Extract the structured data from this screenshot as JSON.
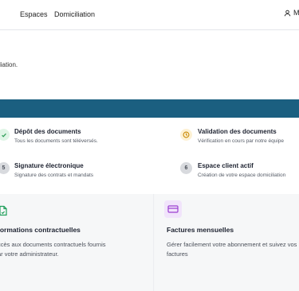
{
  "header": {
    "nav": [
      {
        "label": "Espaces"
      },
      {
        "label": "Domiciliation"
      }
    ],
    "account": {
      "label": "M",
      "icon": "user-icon"
    }
  },
  "intro": {
    "text": "liation."
  },
  "steps": [
    {
      "number": "",
      "status": "done",
      "title": "Dépôt des documents",
      "description": "Tous les documents sont téléversés.",
      "icon": "check-icon"
    },
    {
      "number": "",
      "status": "in-progress",
      "title": "Validation des documents",
      "description": "Vérification en cours par notre équipe",
      "icon": "clock-icon"
    },
    {
      "number": "5",
      "status": "pending",
      "title": "Signature électronique",
      "description": "Signature des contrats et mandats"
    },
    {
      "number": "6",
      "status": "pending",
      "title": "Espace client actif",
      "description": "Création de votre espace domiciliation"
    }
  ],
  "cards": [
    {
      "icon": "document-icon",
      "title": "formations contractuelles",
      "desc_line1": "ccès aux documents contractuels fournis",
      "desc_line2": "ar votre administrateur."
    },
    {
      "icon": "credit-card-icon",
      "title": "Factures mensuelles",
      "desc_line1": "Gérer facilement votre abonnement et suivez vos",
      "desc_line2": "factures"
    }
  ],
  "colors": {
    "accent_bar": "#1b5f80",
    "done": "#2e9d57",
    "in_progress": "#c98a06",
    "document_icon": "#1f9e5a",
    "card_icon": "#9b3fd0"
  }
}
